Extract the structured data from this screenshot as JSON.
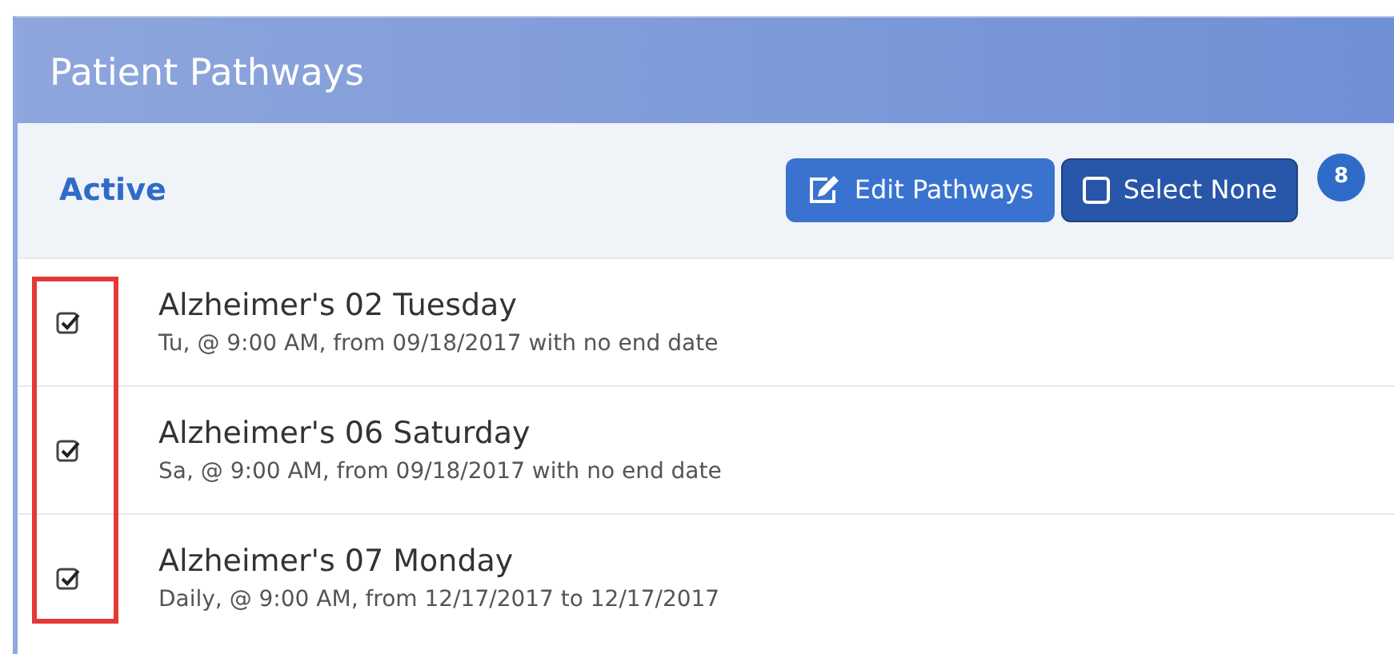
{
  "panel": {
    "title": "Patient Pathways"
  },
  "toolbar": {
    "filter": "Active",
    "buttons": [
      {
        "kind": "edit",
        "label": "Edit Pathways"
      },
      {
        "kind": "select-none",
        "label": "Select None"
      }
    ],
    "count": "8"
  },
  "pathways": [
    {
      "name": "Alzheimer's 02 Tuesday",
      "schedule": "Tu, @ 9:00 AM, from 09/18/2017 with no end date",
      "checked": true
    },
    {
      "name": "Alzheimer's 06 Saturday",
      "schedule": "Sa, @ 9:00 AM, from 09/18/2017 with no end date",
      "checked": true
    },
    {
      "name": "Alzheimer's 07 Monday",
      "schedule": "Daily, @ 9:00 AM, from 12/17/2017 to 12/17/2017",
      "checked": true
    }
  ]
}
